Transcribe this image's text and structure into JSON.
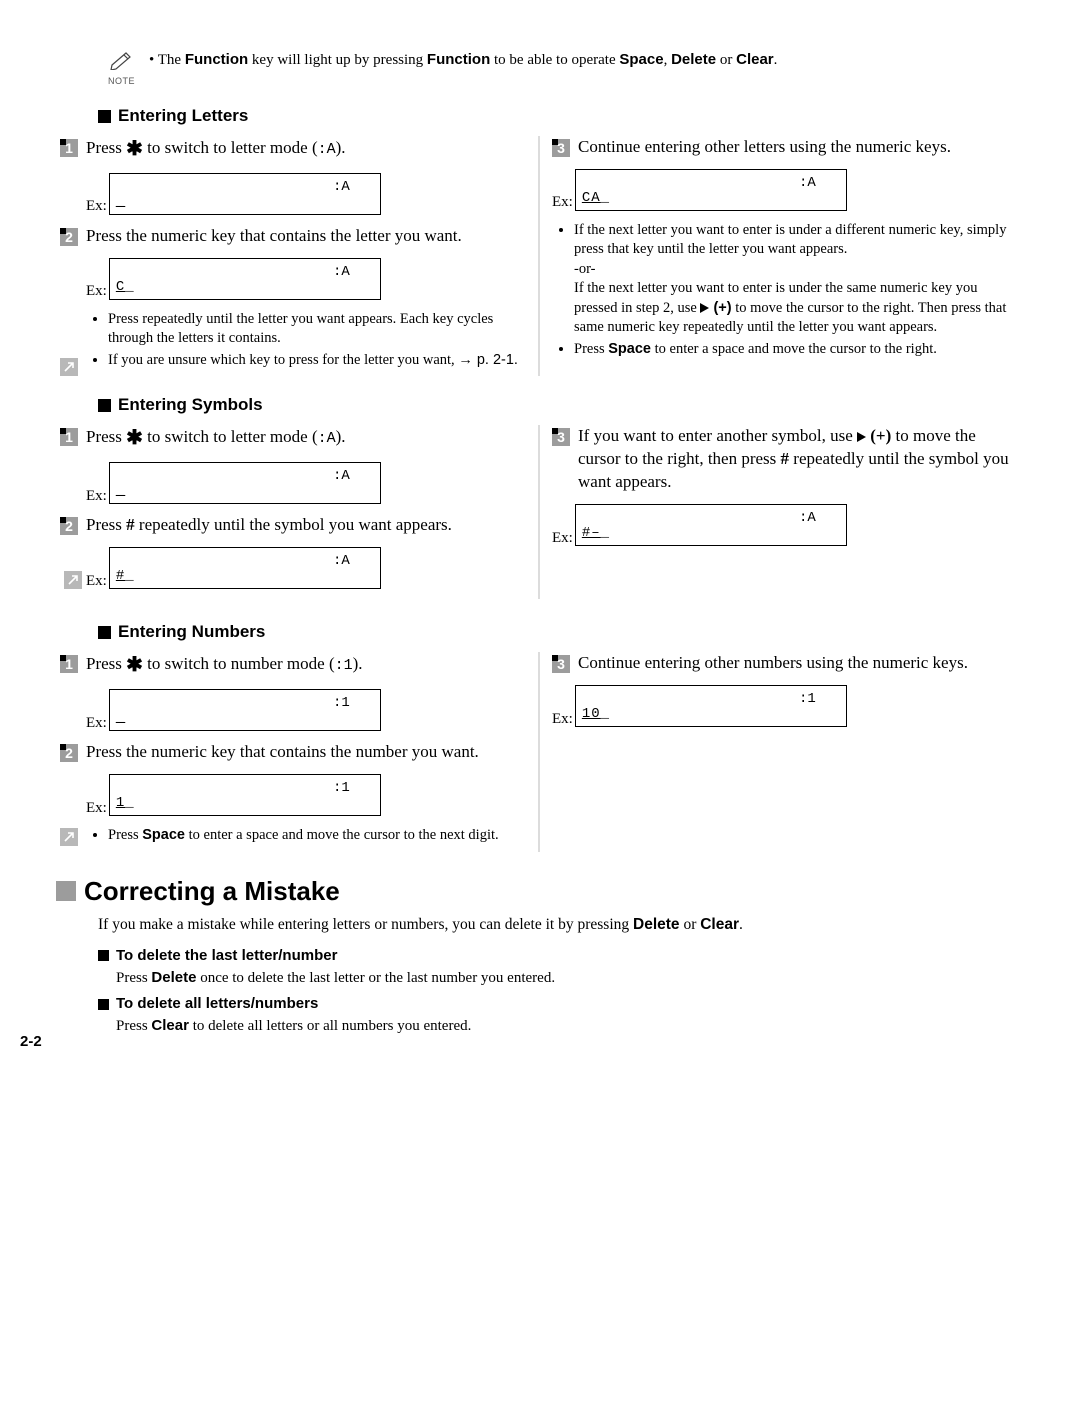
{
  "note": {
    "label": "NOTE",
    "bullet": "•",
    "pre": "The ",
    "k1": "Function",
    "mid1": " key will light up by pressing ",
    "k2": "Function",
    "mid2": " to be able to operate ",
    "k3": "Space",
    "sep1": ", ",
    "k4": "Delete",
    "sep2": " or ",
    "k5": "Clear",
    "end": "."
  },
  "letters": {
    "heading": "Entering Letters",
    "s1": {
      "num": "1",
      "pre": "Press ",
      "post": " to switch to letter mode (",
      "mode": ":A",
      "close": ")."
    },
    "d1": {
      "mode": ":A",
      "val": "_"
    },
    "s2": {
      "num": "2",
      "text": "Press the numeric key that contains the letter you want."
    },
    "d2": {
      "mode": ":A",
      "val": "C",
      "cursor": "_"
    },
    "b1": "Press repeatedly until the letter you want appears. Each key cycles through the letters it contains.",
    "b2_pre": "If you are unsure which key to press for the letter you want, ",
    "b2_ref": "→ p. 2-1.",
    "s3": {
      "num": "3",
      "text": "Continue entering other letters using the numeric keys."
    },
    "d3": {
      "mode": ":A",
      "val": "CA",
      "cursor": "_"
    },
    "r_b1": "If the next letter you want to enter is under a different numeric key, simply press that key until the letter you want appears.",
    "r_or": "-or-",
    "r_b1b_pre": "If the next letter you want to enter is under the same numeric key you pressed in step 2, use ",
    "r_b1b_key": " (+)",
    "r_b1b_post": " to move the cursor to the right. Then press that same numeric key repeatedly until the letter you want appears.",
    "r_b2_pre": "Press ",
    "r_b2_key": "Space",
    "r_b2_post": " to enter a space and move the cursor to the right."
  },
  "symbols": {
    "heading": "Entering Symbols",
    "s1": {
      "num": "1",
      "pre": "Press ",
      "post": " to switch to letter mode (",
      "mode": ":A",
      "close": ")."
    },
    "d1": {
      "mode": ":A",
      "val": "_"
    },
    "s2": {
      "num": "2",
      "pre": "Press ",
      "hash": "#",
      "post": " repeatedly until the symbol you want appears."
    },
    "d2": {
      "mode": ":A",
      "val": "#",
      "cursor": "_"
    },
    "s3": {
      "num": "3",
      "pre": "If you want to enter another symbol, use ",
      "plus": " (+)",
      "mid": " to move the cursor to the right, then press ",
      "hash": "#",
      "post": " repeatedly until the symbol you want appears."
    },
    "d3": {
      "mode": ":A",
      "val": "#–",
      "cursor": "_"
    }
  },
  "numbers": {
    "heading": "Entering Numbers",
    "s1": {
      "num": "1",
      "pre": "Press ",
      "post": " to switch to number mode (",
      "mode": ":1",
      "close": ")."
    },
    "d1": {
      "mode": ":1",
      "val": "_"
    },
    "s2": {
      "num": "2",
      "text": "Press the numeric key that contains the number you want."
    },
    "d2": {
      "mode": ":1",
      "val": "1",
      "cursor": "_"
    },
    "b1_pre": "Press ",
    "b1_key": "Space",
    "b1_post": " to enter a space and move the cursor to the next digit.",
    "s3": {
      "num": "3",
      "text": "Continue entering other numbers using the numeric keys."
    },
    "d3": {
      "mode": ":1",
      "val": "10",
      "cursor": "_"
    }
  },
  "correcting": {
    "heading": "Correcting a Mistake",
    "intro_pre": "If you make a mistake while entering letters or numbers, you can delete it by pressing ",
    "k1": "Delete",
    "or": " or ",
    "k2": "Clear",
    "end": ".",
    "h1": "To delete the last letter/number",
    "p1_pre": "Press ",
    "p1_key": "Delete",
    "p1_post": " once to delete the last letter or the last number you entered.",
    "h2": "To delete all letters/numbers",
    "p2_pre": "Press ",
    "p2_key": "Clear",
    "p2_post": " to delete all letters or all numbers you entered."
  },
  "ex": "Ex:",
  "page": "2-2"
}
